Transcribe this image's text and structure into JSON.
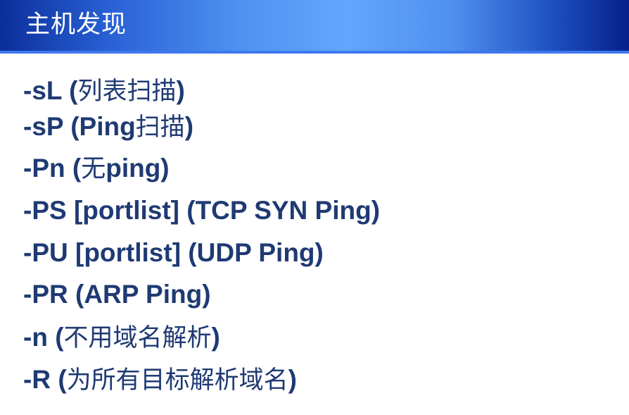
{
  "slide": {
    "title": "主机发现"
  },
  "bullets": [
    {
      "opt": "-sL (",
      "cn": "列表扫描",
      "end": ")"
    },
    {
      "opt": "-sP (Ping",
      "cn": "扫描",
      "end": ")"
    },
    {
      "opt": "-Pn (",
      "cn": "无",
      "end": "ping)"
    },
    {
      "opt": "-PS [portlist] (TCP SYN Ping)",
      "cn": "",
      "end": ""
    },
    {
      "opt": "-PU [portlist] (UDP Ping)",
      "cn": "",
      "end": ""
    },
    {
      "opt": "-PR (ARP Ping)",
      "cn": "",
      "end": ""
    },
    {
      "opt": "-n (",
      "cn": "不用域名解析",
      "end": ")"
    },
    {
      "opt": "-R (",
      "cn": "为所有目标解析域名",
      "end": ")"
    }
  ]
}
